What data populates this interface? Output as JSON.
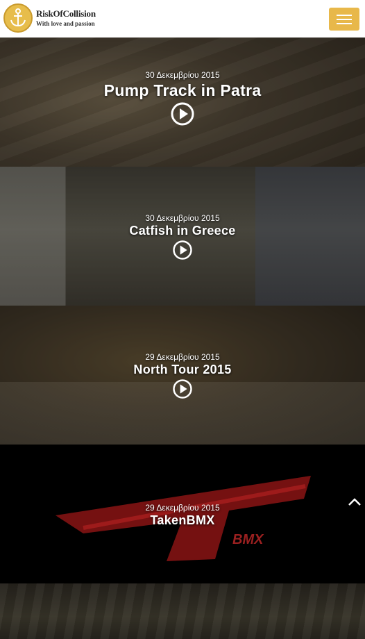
{
  "header": {
    "logo_title": "RiskOfCollision",
    "logo_tagline": "With love and passion",
    "logo_icon": "anchor-icon",
    "menu_icon": "hamburger-icon",
    "accent_color": "#e8b84a"
  },
  "posts": [
    {
      "date": "30 Δεκεμβρίου 2015",
      "title": "Pump Track in Patra",
      "has_play": true
    },
    {
      "date": "30 Δεκεμβρίου 2015",
      "title": "Catfish in Greece",
      "has_play": true
    },
    {
      "date": "29 Δεκεμβρίου 2015",
      "title": "North Tour 2015",
      "has_play": true
    },
    {
      "date": "29 Δεκεμβρίου 2015",
      "title": "TakenBMX",
      "has_play": false
    }
  ],
  "back_to_top_icon": "chevron-up-icon"
}
